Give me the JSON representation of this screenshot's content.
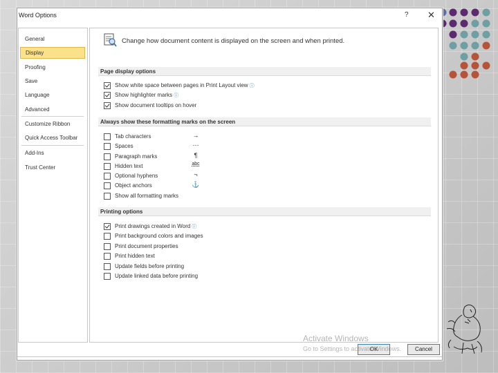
{
  "window": {
    "title": "Word Options",
    "help": "?",
    "close": "✕"
  },
  "nav": {
    "items": [
      {
        "label": "General",
        "selected": false
      },
      {
        "label": "Display",
        "selected": true
      },
      {
        "label": "Proofing",
        "selected": false
      },
      {
        "label": "Save",
        "selected": false
      },
      {
        "label": "Language",
        "selected": false
      },
      {
        "label": "Advanced",
        "selected": false
      },
      {
        "label": "Customize Ribbon",
        "selected": false
      },
      {
        "label": "Quick Access Toolbar",
        "selected": false
      },
      {
        "label": "Add-Ins",
        "selected": false
      },
      {
        "label": "Trust Center",
        "selected": false
      }
    ]
  },
  "header": {
    "text": "Change how document content is displayed on the screen and when printed.",
    "icon": "display-settings-icon"
  },
  "sections": {
    "page_display": {
      "title": "Page display options",
      "options": [
        {
          "label": "Show white space between pages in Print Layout view",
          "checked": true,
          "info": true
        },
        {
          "label": "Show highlighter marks",
          "checked": true,
          "info": true
        },
        {
          "label": "Show document tooltips on hover",
          "checked": true,
          "info": false
        }
      ]
    },
    "formatting_marks": {
      "title": "Always show these formatting marks on the screen",
      "options": [
        {
          "label": "Tab characters",
          "checked": false,
          "glyph": "→"
        },
        {
          "label": "Spaces",
          "checked": false,
          "glyph": "···"
        },
        {
          "label": "Paragraph marks",
          "checked": false,
          "glyph": "¶"
        },
        {
          "label": "Hidden text",
          "checked": false,
          "glyph": "abc"
        },
        {
          "label": "Optional hyphens",
          "checked": false,
          "glyph": "¬"
        },
        {
          "label": "Object anchors",
          "checked": false,
          "glyph": "⚓"
        },
        {
          "label": "Show all formatting marks",
          "checked": false,
          "glyph": ""
        }
      ]
    },
    "printing": {
      "title": "Printing options",
      "options": [
        {
          "label": "Print drawings created in Word",
          "checked": true,
          "info": true
        },
        {
          "label": "Print background colors and images",
          "checked": false,
          "info": false
        },
        {
          "label": "Print document properties",
          "checked": false,
          "info": false
        },
        {
          "label": "Print hidden text",
          "checked": false,
          "info": false
        },
        {
          "label": "Update fields before printing",
          "checked": false,
          "info": false
        },
        {
          "label": "Update linked data before printing",
          "checked": false,
          "info": false
        }
      ]
    }
  },
  "buttons": {
    "ok": "OK",
    "cancel": "Cancel"
  },
  "watermark": {
    "line1": "Activate Windows",
    "line2": "Go to Settings to activate Windows."
  },
  "colors": {
    "selected_bg": "#fbe28a",
    "dot_purple": "#5c2a6e",
    "dot_teal": "#6f9ea3",
    "dot_orange": "#b6543a"
  }
}
